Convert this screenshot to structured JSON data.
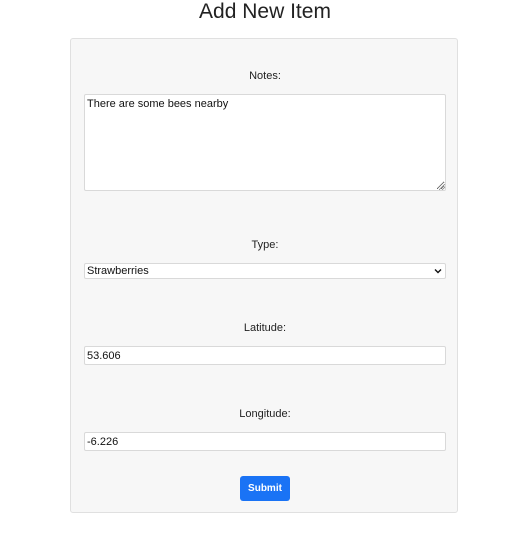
{
  "page": {
    "title": "Add New Item"
  },
  "form": {
    "notes": {
      "label": "Notes:",
      "value": "There are some bees nearby"
    },
    "type": {
      "label": "Type:",
      "selected": "Strawberries"
    },
    "latitude": {
      "label": "Latitude:",
      "value": "53.606"
    },
    "longitude": {
      "label": "Longitude:",
      "value": "-6.226"
    },
    "submit_label": "Submit"
  },
  "colors": {
    "accent": "#1a73f5",
    "card_background": "#f7f7f7"
  },
  "icons": {
    "select_arrow": "chevron-down-icon",
    "textarea_grip": "resize-grip-icon"
  }
}
